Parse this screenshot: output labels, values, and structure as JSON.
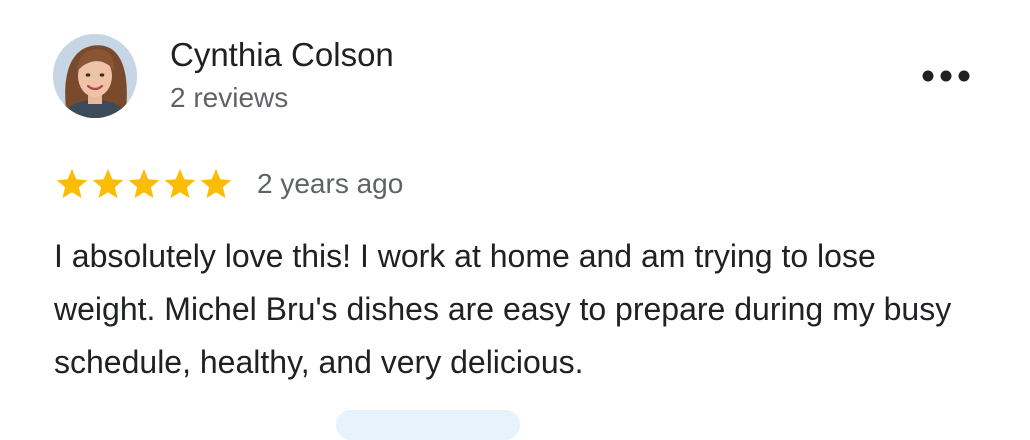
{
  "review": {
    "author": {
      "name": "Cynthia Colson",
      "review_count": "2 reviews",
      "avatar": "profile-photo"
    },
    "more_options_icon": "more-horizontal-icon",
    "rating": {
      "value": 5,
      "max": 5,
      "star_color": "#FBBC04"
    },
    "date": "2 years ago",
    "text": "I absolutely love this! I work at home and am trying to lose weight. Michel Bru's dishes are easy to prepare during my busy schedule, healthy, and very delicious."
  }
}
